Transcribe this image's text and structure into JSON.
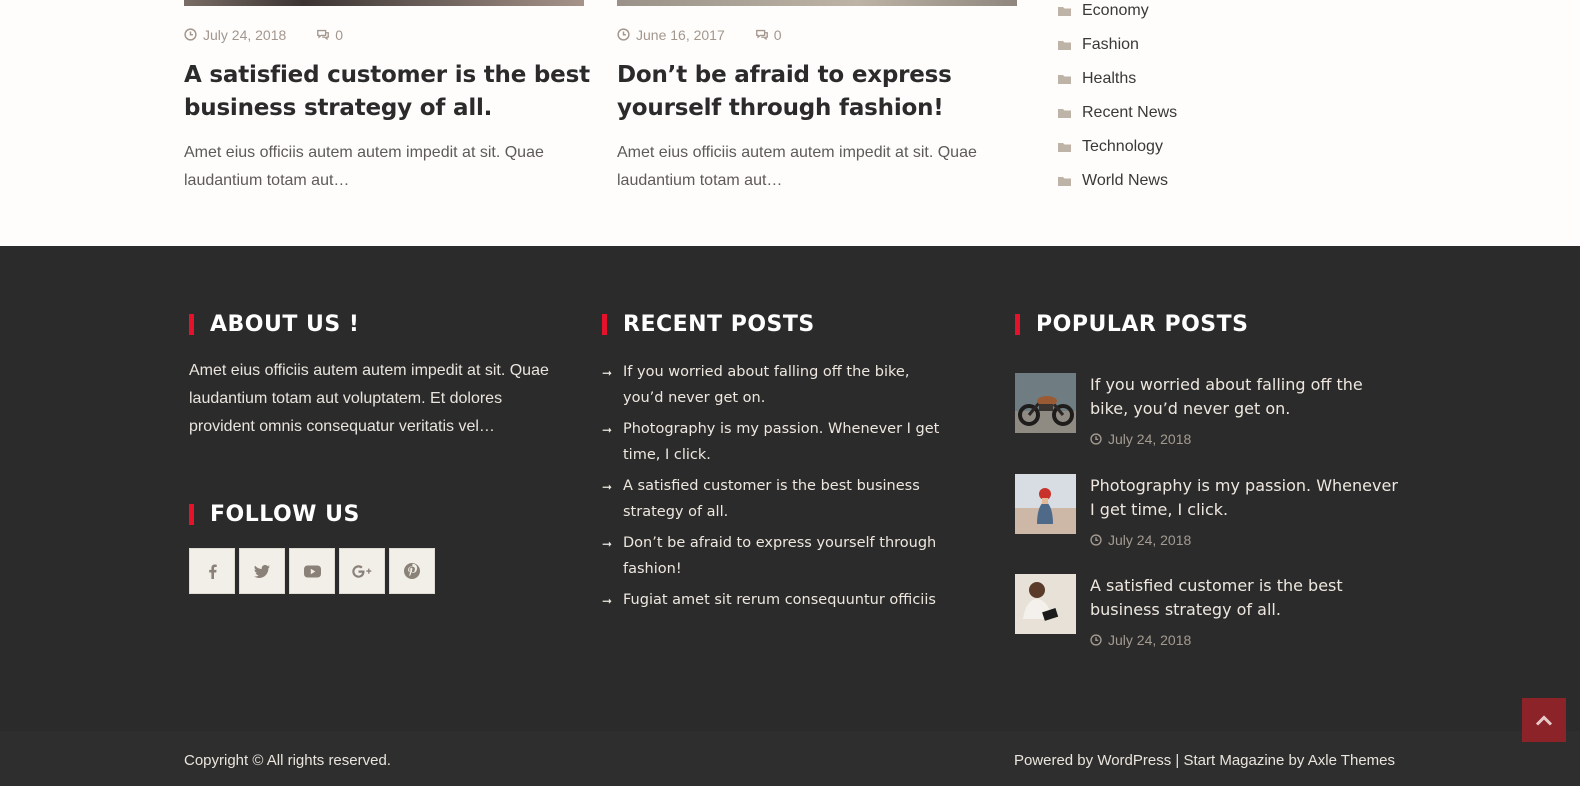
{
  "posts": [
    {
      "date": "July 24, 2018",
      "comments": "0",
      "title": "A satisfied customer is the best business strategy of all.",
      "excerpt": "Amet eius officiis autem autem impedit at sit. Quae laudantium totam aut…"
    },
    {
      "date": "June 16, 2017",
      "comments": "0",
      "title": "Don’t be afraid to express yourself through fashion!",
      "excerpt": "Amet eius officiis autem autem impedit at sit. Quae laudantium totam aut…"
    }
  ],
  "categories": [
    "Economy",
    "Fashion",
    "Healths",
    "Recent News",
    "Technology",
    "World News"
  ],
  "footer": {
    "about": {
      "title": "ABOUT US !",
      "text": "Amet eius officiis autem autem impedit at sit. Quae laudantium totam aut voluptatem. Et dolores provident omnis consequatur veritatis vel…"
    },
    "follow": {
      "title": "FOLLOW US",
      "icons": [
        "facebook-icon",
        "twitter-icon",
        "youtube-icon",
        "google-plus-icon",
        "pinterest-icon"
      ]
    },
    "recent": {
      "title": "RECENT POSTS",
      "items": [
        "If you worried about falling off the bike, you’d never get on.",
        "Photography is my passion. Whenever I get time, I click.",
        "A satisfied customer is the best business strategy of all.",
        "Don’t be afraid to express yourself through fashion!",
        "Fugiat amet sit rerum consequuntur officiis"
      ]
    },
    "popular": {
      "title": "POPULAR POSTS",
      "items": [
        {
          "title": "If you worried about falling off the bike, you’d never get on.",
          "date": "July 24, 2018"
        },
        {
          "title": "Photography is my passion. Whenever I get time, I click.",
          "date": "July 24, 2018"
        },
        {
          "title": "A satisfied customer is the best business strategy of all.",
          "date": "July 24, 2018"
        }
      ]
    }
  },
  "bottom": {
    "copyright": "Copyright © All rights reserved.",
    "powered_prefix": "Powered by ",
    "wordpress": "WordPress",
    "separator": " | ",
    "theme": "Start Magazine",
    "by": " by ",
    "author": "Axle Themes"
  },
  "colors": {
    "accent": "#e5122b",
    "footer_bg": "#2c2b2b",
    "back_to_top": "#8b2329"
  }
}
